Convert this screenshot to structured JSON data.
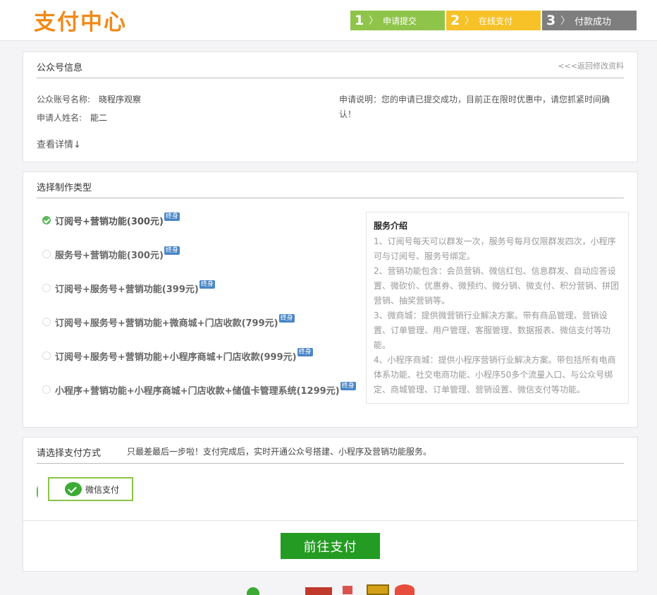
{
  "header": {
    "brand": "支付中心",
    "steps": [
      {
        "num": "1",
        "label": "申请提交"
      },
      {
        "num": "2",
        "label": "在线支付"
      },
      {
        "num": "3",
        "label": "付款成功"
      }
    ]
  },
  "account": {
    "title": "公众号信息",
    "back_link": "<<<返回修改资料",
    "name_label": "公众账号名称:",
    "name_value": "晓程序观察",
    "applicant_label": "申请人姓名:",
    "applicant_value": "能二",
    "note": "申请说明：您的申请已提交成功，目前正在限时优惠中，请您抓紧时间确认！",
    "details_link": "查看详情↓"
  },
  "plan": {
    "title": "选择制作类型",
    "tag": "终身",
    "options": [
      {
        "label": "订阅号+营销功能(300元)",
        "selected": true
      },
      {
        "label": "服务号+营销功能(300元)",
        "selected": false
      },
      {
        "label": "订阅号+服务号+营销功能(399元)",
        "selected": false
      },
      {
        "label": "订阅号+服务号+营销功能+微商城+门店收款(799元)",
        "selected": false
      },
      {
        "label": "订阅号+服务号+营销功能+小程序商城+门店收款(999元)",
        "selected": false
      },
      {
        "label": "小程序+营销功能+小程序商城+门店收款+储值卡管理系统(1299元)",
        "selected": false
      }
    ],
    "service": {
      "title": "服务介绍",
      "lines": [
        "1、订阅号每天可以群发一次，服务号每月仅限群发四次，小程序",
        "可与订阅号、服务号绑定。",
        "2、营销功能包含：会员营销、微信红包、信息群发、自动应答设",
        "置、微砍价、优惠券、微预约、微分销、微支付、积分营销、拼团",
        "营销、抽奖营销等。",
        "3、微商城：提供微营销行业解决方案。带有商品管理、营销设",
        "置、订单管理、用户管理、客服管理、数据报表、微信支付等功",
        "能。",
        "4、小程序商城：提供小程序营销行业解决方案。带包括所有电商",
        "体系功能、社交电商功能、小程序50多个流量入口、与公众号绑",
        "定、商城管理、订单管理、营销设置、微信支付等功能。"
      ]
    }
  },
  "payment": {
    "title": "请选择支付方式",
    "hint": "只最差最后一步啦！支付完成后，实时开通公众号搭建、小程序及营销功能服务。",
    "method": "微信支付",
    "submit": "前往支付"
  },
  "colors": {
    "brand": "#f08a1a",
    "step1": "#8fc44a",
    "step2": "#f6c228",
    "step3": "#7e7e7e",
    "pay_button": "#249b22",
    "check": "#5cb85c"
  }
}
